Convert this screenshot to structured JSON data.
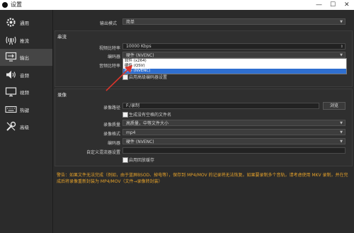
{
  "window": {
    "title": "设置",
    "min_glyph": "—",
    "max_glyph": "☐",
    "close_glyph": "✕"
  },
  "sidebar": {
    "items": [
      {
        "label": "通用",
        "icon": "gear-icon"
      },
      {
        "label": "推流",
        "icon": "broadcast-icon"
      },
      {
        "label": "输出",
        "icon": "output-icon"
      },
      {
        "label": "音频",
        "icon": "speaker-icon"
      },
      {
        "label": "视频",
        "icon": "monitor-icon"
      },
      {
        "label": "热键",
        "icon": "keyboard-icon"
      },
      {
        "label": "高级",
        "icon": "wrench-icon"
      }
    ],
    "active_index": 2
  },
  "output": {
    "mode_label": "输出模式",
    "mode_value": "简单"
  },
  "streaming": {
    "title": "串流",
    "video_bitrate_label": "视频比特率",
    "video_bitrate_value": "10000 Kbps",
    "encoder_label": "编码器",
    "encoder_value": "硬件 (NVENC)",
    "audio_bitrate_label": "音频比特率",
    "advanced_encoder_label": "启用高级编码器设置",
    "dropdown_options": [
      "软件 (x264)",
      "硬件 (QSV)",
      "硬件 (NVENC)"
    ],
    "dropdown_selected": 2
  },
  "recording": {
    "title": "录像",
    "path_label": "录像路径",
    "path_value": "F:/录制",
    "browse_label": "浏览",
    "no_space_label": "生成没有空格的文件名",
    "quality_label": "录像质量",
    "quality_value": "高质量，中等文件大小",
    "format_label": "录像格式",
    "format_value": "mp4",
    "encoder_label": "编码器",
    "encoder_value": "硬件 (NVENC)",
    "muxer_label": "自定义混流器设置",
    "muxer_value": "",
    "replay_label": "启用回放缓存"
  },
  "warning": "警告：如果文件无法完成（例如，由于蓝屏BSOD、掉电等），保存到 MP4/MOV 的记录将无法恢复。如果要录制多个音轨，请考虑使用 MKV 录制，并在完成后将录像重新封装为 MP4/MOV（文件→录像转封装）",
  "colors": {
    "warning": "#e5a22a",
    "selection": "#2f6fd0",
    "annotation_arrow": "#d9342b"
  }
}
